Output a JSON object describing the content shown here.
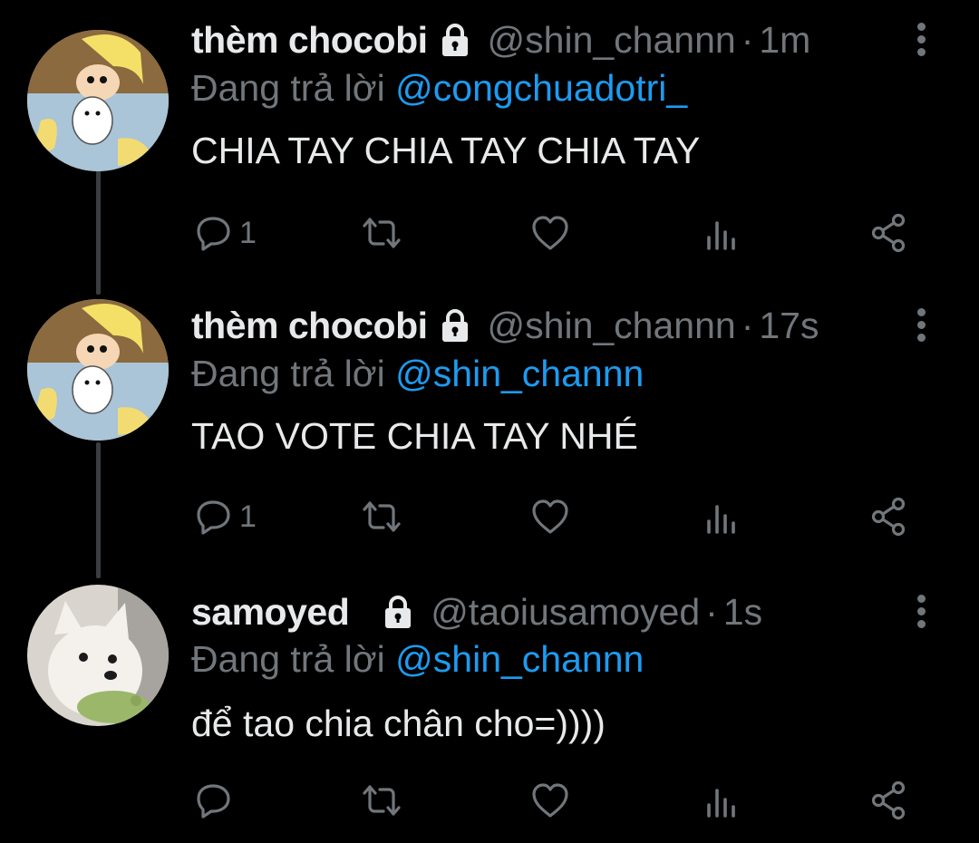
{
  "tweets": [
    {
      "name": "thèm chocobi",
      "handle": "@shin_channn",
      "dot": "·",
      "time": "1m",
      "replying_prefix": "Đang trả lời",
      "replying_to": "@congchuadotri_",
      "text": "CHIA TAY CHIA TAY CHIA TAY",
      "reply_count": "1",
      "avatar": "shin-chan-avatar"
    },
    {
      "name": "thèm chocobi",
      "handle": "@shin_channn",
      "dot": "·",
      "time": "17s",
      "replying_prefix": "Đang trả lời",
      "replying_to": "@shin_channn",
      "text": "TAO VOTE CHIA TAY NHÉ",
      "reply_count": "1",
      "avatar": "shin-chan-avatar"
    },
    {
      "name": "samoyed",
      "handle": "@taoiusamoyed",
      "dot": "·",
      "time": "1s",
      "replying_prefix": "Đang trả lời",
      "replying_to": "@shin_channn",
      "text": "để tao chia chân cho=))))",
      "reply_count": "",
      "avatar": "samoyed-dog-avatar"
    }
  ],
  "colors": {
    "background": "#000000",
    "text": "#e7e9ea",
    "muted": "#71767b",
    "mention": "#1d9bf0",
    "thread_line": "#3a3d40"
  },
  "icons": [
    "lock-icon",
    "more-icon",
    "reply-icon",
    "retweet-icon",
    "like-icon",
    "analytics-icon",
    "share-icon"
  ]
}
